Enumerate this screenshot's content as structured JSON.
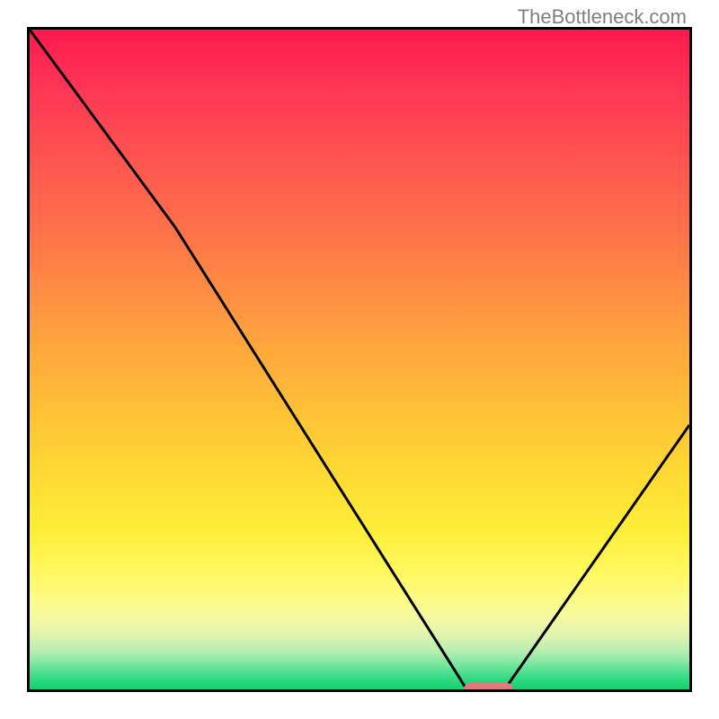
{
  "watermark": "TheBottleneck.com",
  "chart_data": {
    "type": "line",
    "title": "",
    "xlabel": "",
    "ylabel": "",
    "xlim": [
      0,
      100
    ],
    "ylim": [
      0,
      100
    ],
    "grid": false,
    "series": [
      {
        "name": "bottleneck-curve",
        "x": [
          0,
          22,
          66,
          72,
          100
        ],
        "y": [
          100,
          70,
          0,
          0,
          40
        ]
      }
    ],
    "marker": {
      "x_range": [
        66,
        73
      ],
      "y": 0,
      "color": "#e37a7a"
    },
    "background": "vertical-gradient-red-to-green"
  }
}
